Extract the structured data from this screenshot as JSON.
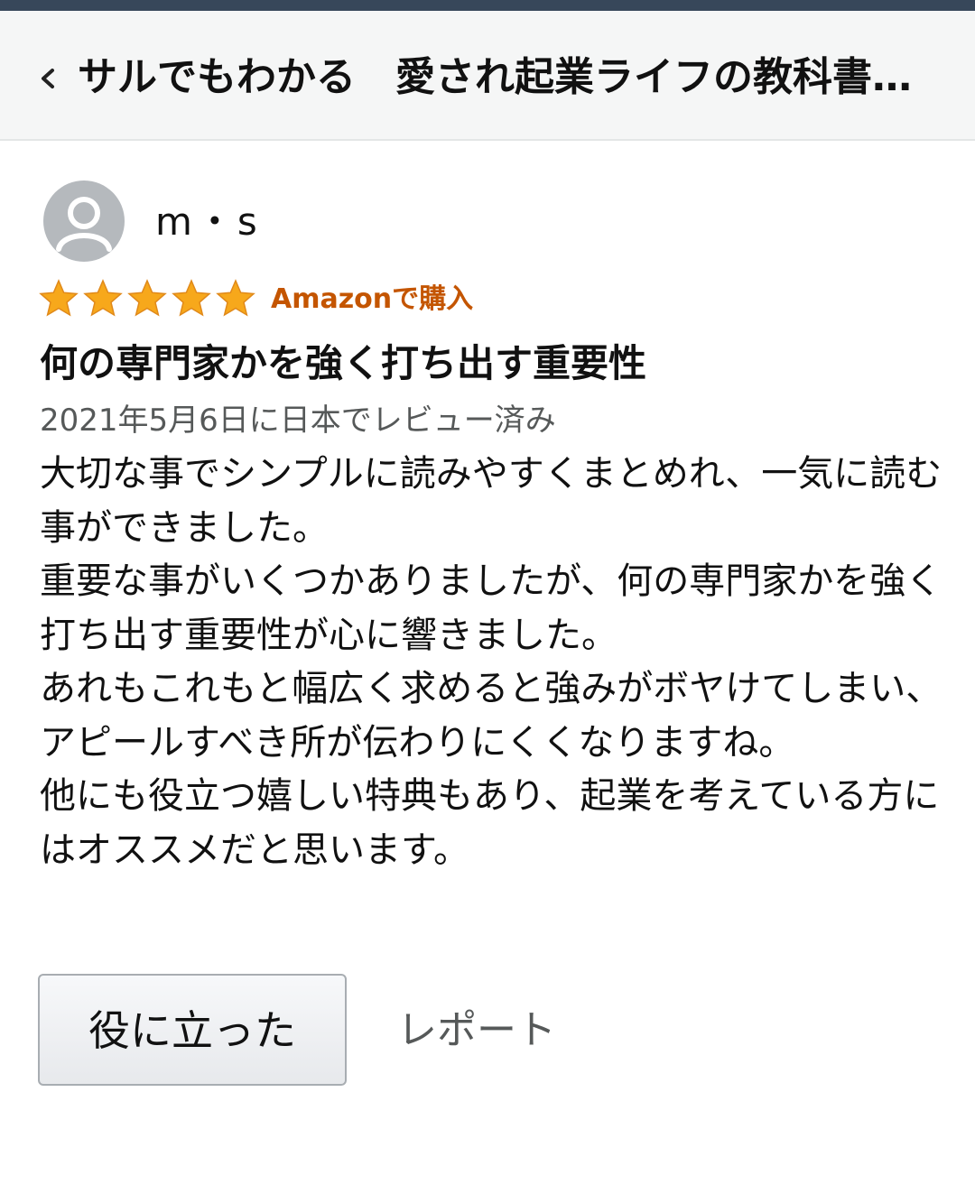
{
  "header": {
    "back_icon": "chevron-left-icon",
    "title": "サルでもわかる　愛され起業ライフの教科書…"
  },
  "review": {
    "reviewer": {
      "avatar_icon": "default-user-icon",
      "name": "m・s"
    },
    "rating": {
      "stars": 5,
      "max": 5,
      "star_icon": "star-icon"
    },
    "verified_badge": "Amazonで購入",
    "title": "何の専門家かを強く打ち出す重要性",
    "date": "2021年5月6日に日本でレビュー済み",
    "body": [
      "大切な事でシンプルに読みやすくまとめれ、一気に読む事ができました。",
      "重要な事がいくつかありましたが、何の専門家かを強く打ち出す重要性が心に響きました。",
      "あれもこれもと幅広く求めると強みがボヤけてしまい、アピールすべき所が伝わりにくくなりますね。",
      "他にも役立つ嬉しい特典もあり、起業を考えている方にはオススメだと思います。"
    ],
    "helpful_button": "役に立った",
    "report_link": "レポート"
  },
  "colors": {
    "top_strip": "#37475a",
    "header_bg": "#f5f6f6",
    "star": "#f7a81b",
    "badge": "#c45500",
    "secondary_text": "#565959"
  }
}
